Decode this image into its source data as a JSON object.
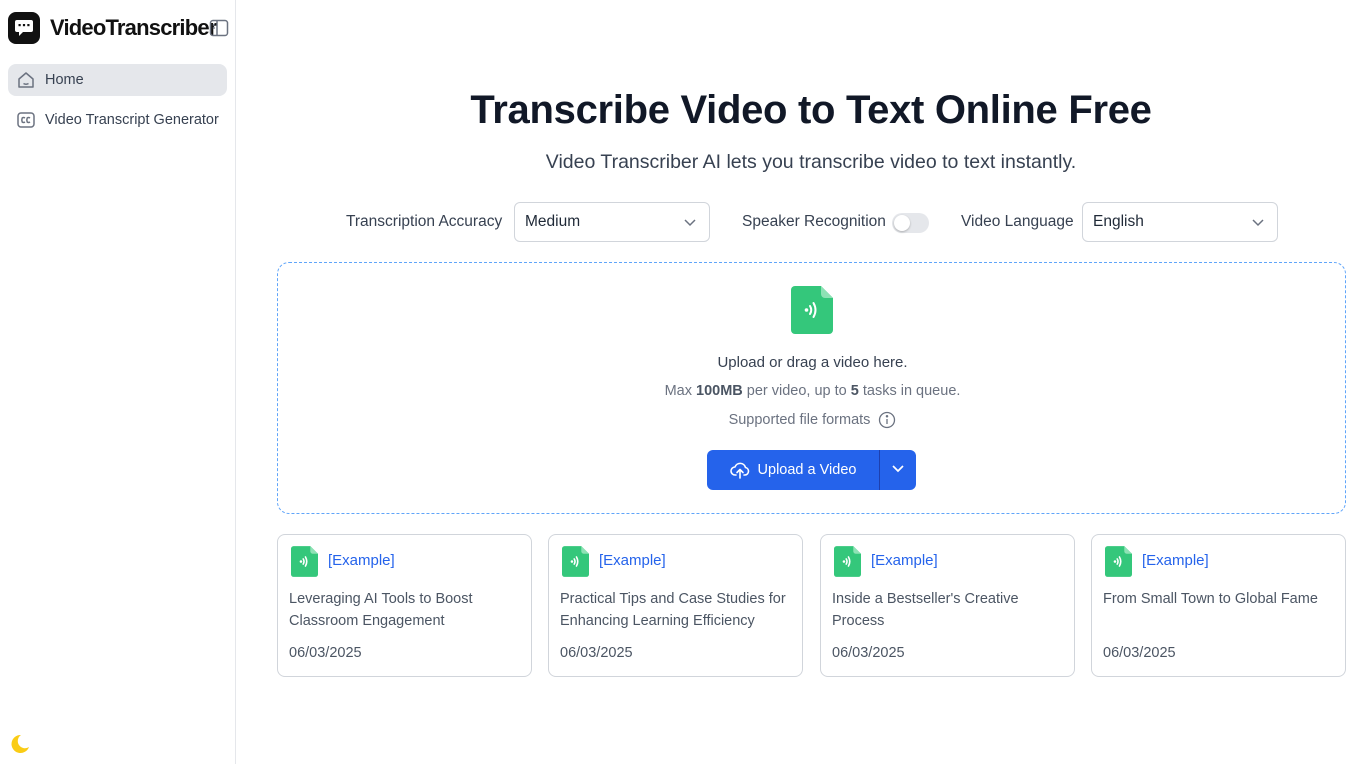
{
  "app": {
    "name": "VideoTranscriber"
  },
  "sidebar": {
    "items": [
      {
        "label": "Home",
        "icon": "home-icon",
        "active": true
      },
      {
        "label": "Video Transcript Generator",
        "icon": "closed-captions-icon",
        "active": false
      }
    ]
  },
  "hero": {
    "title": "Transcribe Video to Text Online Free",
    "subtitle": "Video Transcriber AI lets you transcribe video to text instantly."
  },
  "options": {
    "accuracy_label": "Transcription Accuracy",
    "accuracy_value": "Medium",
    "speaker_label": "Speaker Recognition",
    "speaker_enabled": false,
    "language_label": "Video Language",
    "language_value": "English"
  },
  "upload": {
    "prompt": "Upload or drag a video here.",
    "limit_prefix": "Max ",
    "limit_size": "100MB",
    "limit_middle": " per video, up to ",
    "limit_count": "5",
    "limit_suffix": " tasks in queue.",
    "formats_label": "Supported file formats",
    "button_label": "Upload a Video"
  },
  "examples": [
    {
      "tag": "[Example]",
      "title": "Leveraging AI Tools to Boost Classroom Engagement",
      "date": "06/03/2025"
    },
    {
      "tag": "[Example]",
      "title": "Practical Tips and Case Studies for Enhancing Learning Efficiency",
      "date": "06/03/2025"
    },
    {
      "tag": "[Example]",
      "title": "Inside a Bestseller's Creative Process",
      "date": "06/03/2025"
    },
    {
      "tag": "[Example]",
      "title": "From Small Town to Global Fame",
      "date": "06/03/2025"
    }
  ],
  "colors": {
    "accent": "#2563eb",
    "file_icon": "#34c77b",
    "moon": "#facc15",
    "dropzone_border": "#60a5fa"
  }
}
